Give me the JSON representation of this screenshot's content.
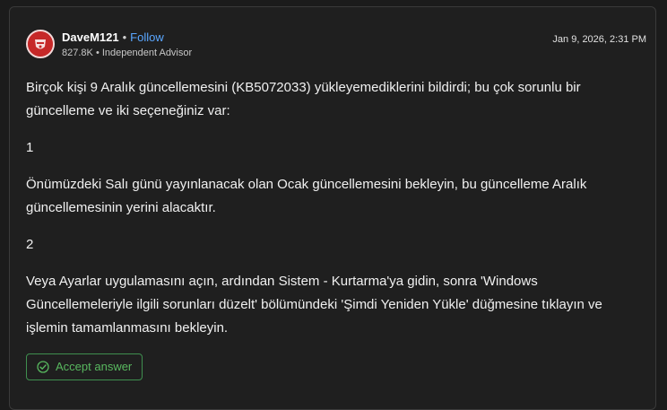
{
  "author": {
    "name": "DaveM121",
    "separator": "•",
    "follow_label": "Follow",
    "points": "827.8K",
    "meta_separator": "•",
    "role": "Independent Advisor",
    "avatar_icon": "arsenal-crest-icon"
  },
  "timestamp": "Jan 9, 2026, 2:31 PM",
  "body": {
    "paragraphs": [
      "Birçok kişi 9 Aralık güncellemesini (KB5072033) yükleyemediklerini bildirdi; bu çok sorunlu bir güncelleme ve iki seçeneğiniz var:",
      "1",
      "Önümüzdeki Salı günü yayınlanacak olan Ocak güncellemesini bekleyin, bu güncelleme Aralık güncellemesinin yerini alacaktır.",
      "2",
      "Veya Ayarlar uygulamasını açın, ardından Sistem - Kurtarma'ya gidin, sonra 'Windows Güncellemeleriyle ilgili sorunları düzelt' bölümündeki 'Şimdi Yeniden Yükle' düğmesine tıklayın ve işlemin tamamlanmasını bekleyin."
    ]
  },
  "actions": {
    "accept_label": "Accept answer",
    "accept_icon": "check-circle-icon"
  },
  "colors": {
    "background": "#1b1b1b",
    "card": "#1f1f1f",
    "link": "#5aa7ff",
    "accept_green": "#58b85f"
  }
}
